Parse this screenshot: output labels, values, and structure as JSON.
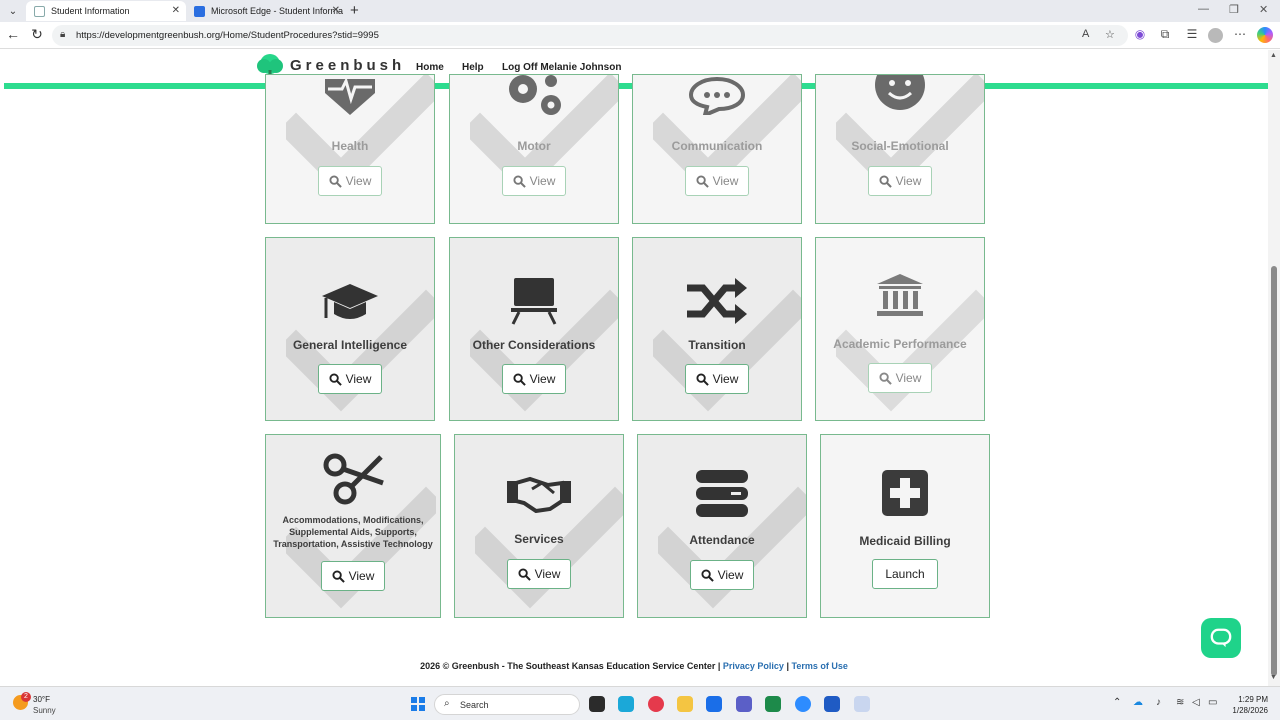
{
  "browser": {
    "tabs": [
      {
        "title": "Student Information",
        "active": true
      },
      {
        "title": "Microsoft Edge - Student Informa",
        "active": false
      }
    ],
    "url": "https://developmentgreenbush.org/Home/StudentProcedures?stid=9995"
  },
  "header": {
    "brand": "Greenbush",
    "nav": [
      "Home",
      "Help",
      "Log Off Melanie Johnson"
    ]
  },
  "tiles": [
    {
      "label": "Health",
      "button": "View",
      "icon": "heartbeat-icon",
      "dim": true
    },
    {
      "label": "Motor",
      "button": "View",
      "icon": "gears-icon",
      "dim": true
    },
    {
      "label": "Communication",
      "button": "View",
      "icon": "chat-bubble-icon",
      "dim": true
    },
    {
      "label": "Social-Emotional",
      "button": "View",
      "icon": "smiley-icon",
      "dim": true
    },
    {
      "label": "General Intelligence",
      "button": "View",
      "icon": "graduation-cap-icon",
      "dim": false
    },
    {
      "label": "Other Considerations",
      "button": "View",
      "icon": "desk-monitor-icon",
      "dim": false
    },
    {
      "label": "Transition",
      "button": "View",
      "icon": "shuffle-icon",
      "dim": false
    },
    {
      "label": "Academic Performance",
      "button": "View",
      "icon": "institution-icon",
      "dim": true
    },
    {
      "label": "Accommodations, Modifications, Supplemental Aids, Supports, Transportation, Assistive Technology",
      "button": "View",
      "icon": "scissors-icon",
      "dim": false
    },
    {
      "label": "Services",
      "button": "View",
      "icon": "handshake-icon",
      "dim": false
    },
    {
      "label": "Attendance",
      "button": "View",
      "icon": "server-stack-icon",
      "dim": false
    },
    {
      "label": "Medicaid Billing",
      "button": "Launch",
      "icon": "plus-square-icon",
      "dim": false
    }
  ],
  "footer": {
    "text": "2026 © Greenbush - The Southeast Kansas Education Service Center |",
    "privacy": "Privacy Policy",
    "sep": "|",
    "terms": "Terms of Use"
  },
  "taskbar": {
    "weather_temp": "30°F",
    "weather_cond": "Sunny",
    "weather_badge": "2",
    "search": "Search",
    "time": "1:29 PM",
    "date": "1/28/2026"
  },
  "colors": {
    "accent": "#2ddc8f",
    "tile_border": "#78b98e",
    "chat": "#1fd38a"
  }
}
